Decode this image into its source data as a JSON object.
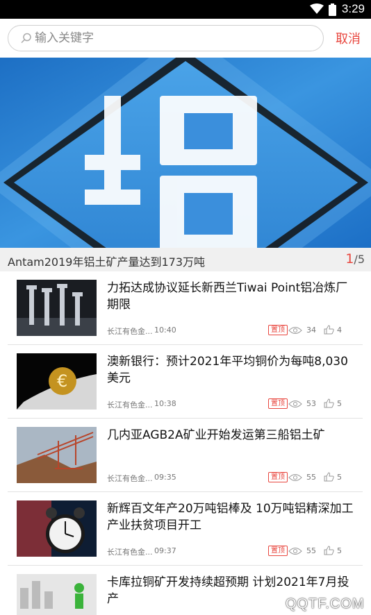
{
  "status_bar": {
    "time": "3:29"
  },
  "search": {
    "placeholder": "输入关键字",
    "cancel_label": "取消"
  },
  "banner": {
    "caption": "Antam2019年铝土矿产量达到173万吨",
    "current_page": "1",
    "total_pages": "/5",
    "glyph": "铝"
  },
  "news": [
    {
      "title": "力拓达成协议延长新西兰Tiwai Point铝冶炼厂期限",
      "source": "长江有色金...",
      "time": "10:40",
      "badge": "置顶",
      "views": "34",
      "likes": "4"
    },
    {
      "title": "澳新银行：预计2021年平均铜价为每吨8,030美元",
      "source": "长江有色金...",
      "time": "10:38",
      "badge": "置顶",
      "views": "53",
      "likes": "5"
    },
    {
      "title": "几内亚AGB2A矿业开始发运第三船铝土矿",
      "source": "长江有色金...",
      "time": "09:35",
      "badge": "置顶",
      "views": "55",
      "likes": "5"
    },
    {
      "title": "新辉百文年产20万吨铝棒及 10万吨铝精深加工产业扶贫项目开工",
      "source": "长江有色金...",
      "time": "09:37",
      "badge": "置顶",
      "views": "55",
      "likes": "5"
    },
    {
      "title": "卡库拉铜矿开发持续超预期 计划2021年7月投产",
      "source": "",
      "time": "",
      "badge": "",
      "views": "",
      "likes": ""
    }
  ],
  "watermark": "QQTF.COM"
}
